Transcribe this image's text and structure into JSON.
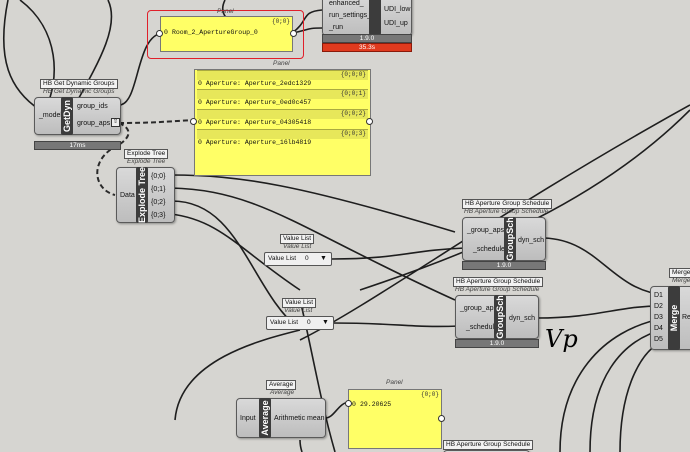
{
  "top_partial": {
    "inputs": [
      "enhanced_",
      "run_settings_",
      "_run"
    ],
    "outputs": [
      "UDI_low",
      "UDI_up"
    ],
    "version": "1.9.0",
    "timing": "35.3s"
  },
  "panel_room": {
    "title": "Panel",
    "index": "{0;0}",
    "row_num": "0",
    "value": "Room_2_ApertureGroup_0"
  },
  "get_dyn": {
    "tag": "HB Get Dynamic Groups",
    "subtitle": "HB Get Dynamic Groups",
    "core": "GetDyn",
    "input": "_model",
    "outputs": [
      "group_ids",
      "group_aps"
    ],
    "timing": "17ms"
  },
  "panel_aps": {
    "title": "Panel",
    "rows": [
      {
        "index": "{0;0;0}",
        "num": "0",
        "value": "Aperture: Aperture_2edc1329"
      },
      {
        "index": "{0;0;1}",
        "num": "0",
        "value": "Aperture: Aperture_0ed0c457"
      },
      {
        "index": "{0;0;2}",
        "num": "0",
        "value": "Aperture: Aperture_04305418"
      },
      {
        "index": "{0;0;3}",
        "num": "0",
        "value": "Aperture: Aperture_16lb4819"
      }
    ]
  },
  "explode": {
    "tag": "Explode Tree",
    "subtitle": "Explode Tree",
    "core": "Explode Tree",
    "input": "Data",
    "outputs": [
      "{0;0}",
      "{0;1}",
      "{0;2}",
      "{0;3}"
    ]
  },
  "group_sch_1": {
    "tag": "HB Aperture Group Schedule",
    "subtitle": "HB Aperture Group Schedule",
    "core": "GroupSch",
    "inputs": [
      "_group_aps",
      "_schedule"
    ],
    "output": "dyn_sch",
    "version": "1.9.0"
  },
  "group_sch_2": {
    "tag": "HB Aperture Group Schedule",
    "subtitle": "HB Aperture Group Schedule",
    "core": "GroupSch",
    "inputs": [
      "_group_aps",
      "_schedule"
    ],
    "output": "dyn_sch",
    "version": "1.9.0"
  },
  "group_sch_3": {
    "tag": "HB Aperture Group Schedule"
  },
  "value_list_1": {
    "tag": "Value List",
    "subtitle": "Value List",
    "label": "Value List",
    "value": "0"
  },
  "value_list_2": {
    "tag": "Value List",
    "subtitle": "Value List",
    "label": "Value List",
    "value": "0"
  },
  "merge": {
    "tag": "Merge",
    "subtitle": "Merge",
    "core": "Merge",
    "inputs": [
      "D1",
      "D2",
      "D3",
      "D4",
      "D5"
    ],
    "output": "Res"
  },
  "average": {
    "tag": "Average",
    "subtitle": "Average",
    "core": "Average",
    "input": "Input",
    "output": "Arithmetic mean"
  },
  "panel_avg": {
    "title": "Panel",
    "index": "{0;0}",
    "row_num": "0",
    "value": "29.20625"
  },
  "annotation": {
    "text": "Vp"
  },
  "colors": {
    "canvas": "#d6d5d1",
    "panel": "#ffff66",
    "error_bar": "#e03a1e",
    "selection": "#e0202a"
  }
}
